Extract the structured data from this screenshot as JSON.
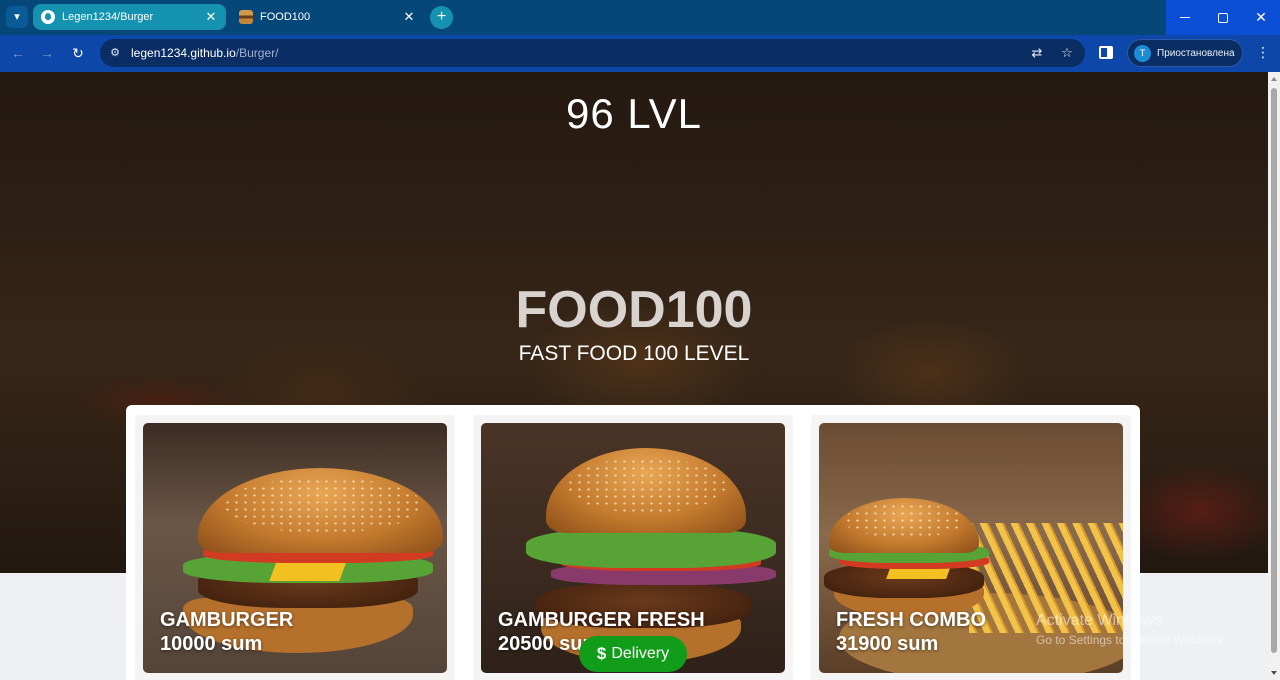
{
  "browser": {
    "tabs": [
      {
        "title": "Legen1234/Burger",
        "icon": "github-icon",
        "active": true
      },
      {
        "title": "FOOD100",
        "icon": "burger-favicon",
        "active": false
      }
    ],
    "url_host": "legen1234.github.io",
    "url_path": "/Burger/",
    "profile_initial": "T",
    "profile_status": "Приостановлена"
  },
  "page": {
    "level": "96 LVL",
    "brand": "FOOD100",
    "tagline": "FAST FOOD 100 LEVEL",
    "menu": [
      {
        "name": "GAMBURGER",
        "price": "10000 sum"
      },
      {
        "name": "GAMBURGER FRESH",
        "price": "20500 sum"
      },
      {
        "name": "FRESH COMBO",
        "price": "31900 sum"
      }
    ],
    "delivery_icon": "$",
    "delivery_label": "Delivery",
    "accent_color": "#119c1a"
  },
  "os_watermark": {
    "line1": "Activate Windows",
    "line2": "Go to Settings to activate Windows."
  }
}
